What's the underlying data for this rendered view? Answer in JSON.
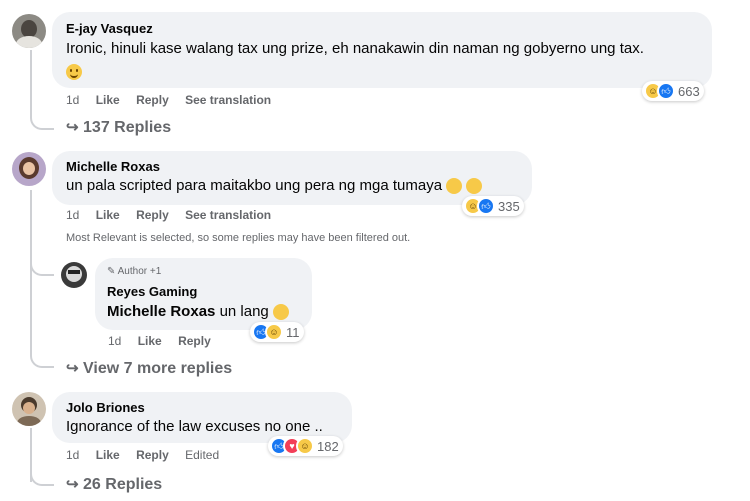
{
  "comments": [
    {
      "author": "E-jay Vasquez",
      "text": "Ironic, hinuli kase walang tax ung prize, eh nanakawin din naman ng gobyerno ung tax.",
      "time": "1d",
      "like": "Like",
      "reply": "Reply",
      "extra": "See translation",
      "reaction_count": "663",
      "reactions": [
        "haha-icon",
        "like-icon"
      ],
      "replies_label": "137 Replies"
    },
    {
      "author": "Michelle Roxas",
      "text": "un pala scripted para maitakbo ung pera ng mga tumaya",
      "time": "1d",
      "like": "Like",
      "reply": "Reply",
      "extra": "See translation",
      "reaction_count": "335",
      "reactions": [
        "haha-icon",
        "like-icon"
      ],
      "note": "Most Relevant is selected, so some replies may have been filtered out."
    },
    {
      "badge": "Author +1",
      "author": "Reyes Gaming",
      "mention": "Michelle Roxas",
      "text": "un lang",
      "time": "1d",
      "like": "Like",
      "reply": "Reply",
      "reaction_count": "11",
      "reactions": [
        "like-icon",
        "haha-icon"
      ],
      "replies_label": "View 7 more replies"
    },
    {
      "author": "Jolo Briones",
      "text": "Ignorance of the law excuses no one ..",
      "time": "1d",
      "like": "Like",
      "reply": "Reply",
      "extra": "Edited",
      "reaction_count": "182",
      "reactions": [
        "like-icon",
        "love-icon",
        "haha-icon"
      ],
      "replies_label": "26 Replies"
    }
  ],
  "colors": {
    "bubble": "#f0f2f5",
    "secondary_text": "#65676b",
    "like_blue": "#1877f2",
    "haha_yellow": "#f7c948",
    "love_red": "#f33e58"
  }
}
